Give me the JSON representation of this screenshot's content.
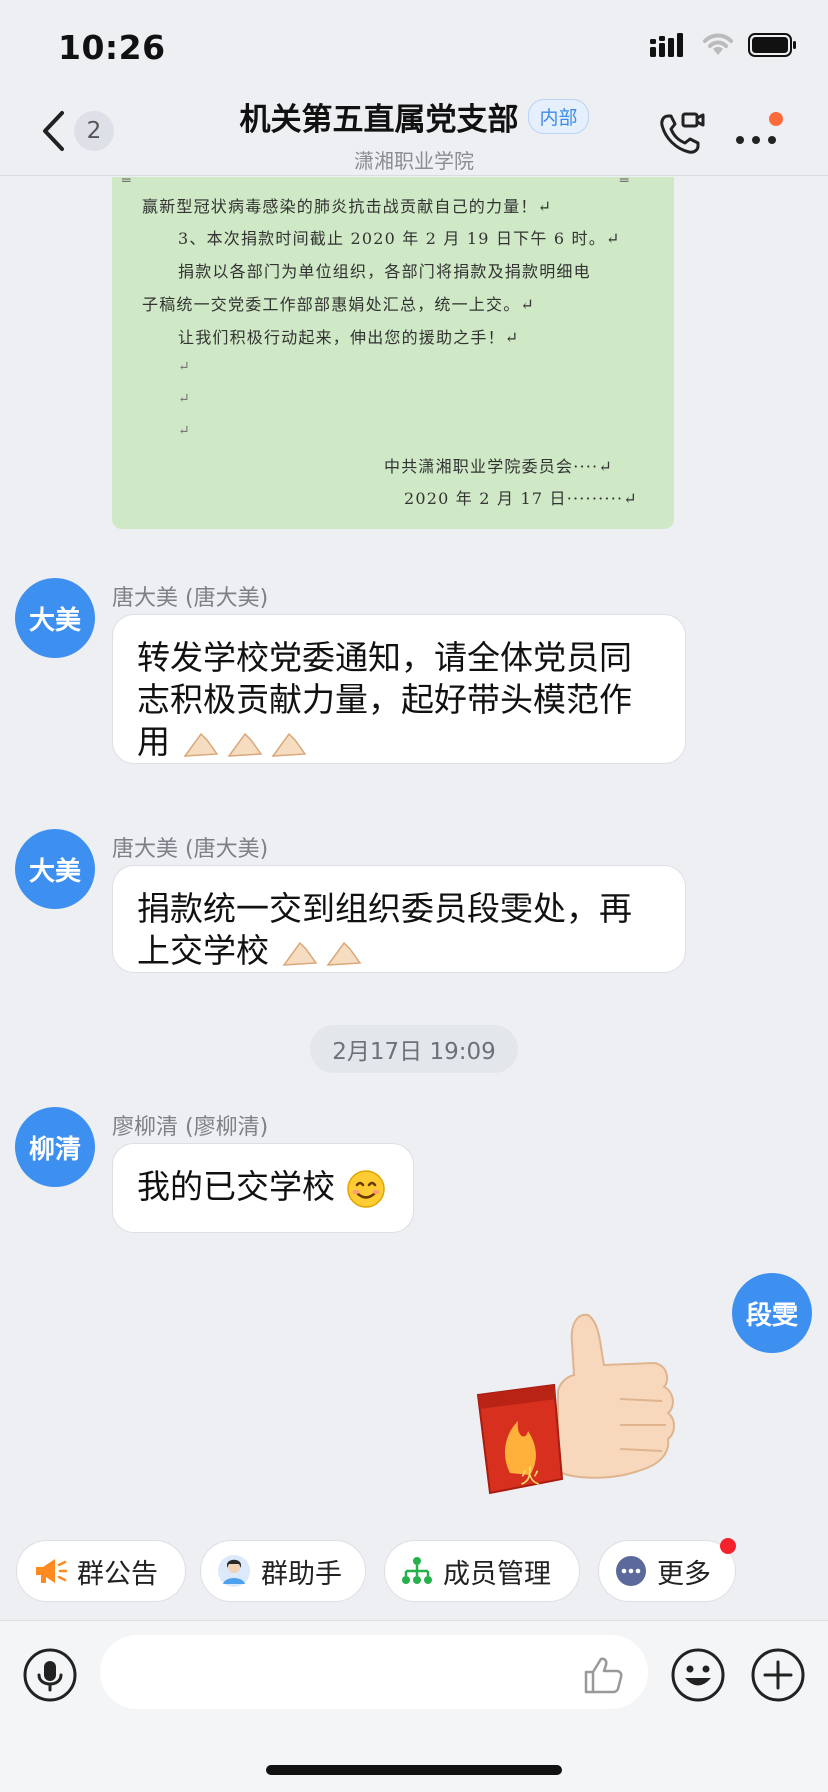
{
  "status_bar": {
    "time": "10:26"
  },
  "header": {
    "unread_count": "2",
    "title": "机关第五直属党支部",
    "badge": "内部",
    "subtitle": "潇湘职业学院"
  },
  "document": {
    "lines": [
      "赢新型冠状病毒感染的肺炎抗击战贡献自己的力量！↵",
      "3、本次捐款时间截止 2020 年 2 月 19 日下午 6 时。↵",
      "捐款以各部门为单位组织，各部门将捐款及捐款明细电",
      "子稿统一交党委工作部部惠娟处汇总，统一上交。↵",
      "让我们积极行动起来，伸出您的援助之手！↵",
      "中共潇湘职业学院委员会····↵",
      "2020 年 2 月 17 日·········↵"
    ]
  },
  "messages": [
    {
      "avatar": "大美",
      "sender": "唐大美 (唐大美)",
      "line1": "转发学校党委通知，请全体党员同",
      "line2": "志积极贡献力量，起好带头模范作",
      "line3": "用"
    },
    {
      "avatar": "大美",
      "sender": "唐大美 (唐大美)",
      "line1": "捐款统一交到组织委员段雯处，再",
      "line2": "上交学校"
    },
    {
      "avatar": "柳清",
      "sender": "廖柳清 (廖柳清)",
      "text": "我的已交学校"
    }
  ],
  "timestamp": "2月17日 19:09",
  "self_avatar": "段雯",
  "quick_actions": [
    {
      "label": "群公告",
      "icon": "megaphone-icon"
    },
    {
      "label": "群助手",
      "icon": "assistant-icon"
    },
    {
      "label": "成员管理",
      "icon": "org-tree-icon"
    },
    {
      "label": "更多",
      "icon": "more-dots-icon"
    }
  ],
  "colors": {
    "accent_blue": "#3d8ff0",
    "doc_background": "#cfe8c6",
    "notification_red": "#f5222d"
  }
}
